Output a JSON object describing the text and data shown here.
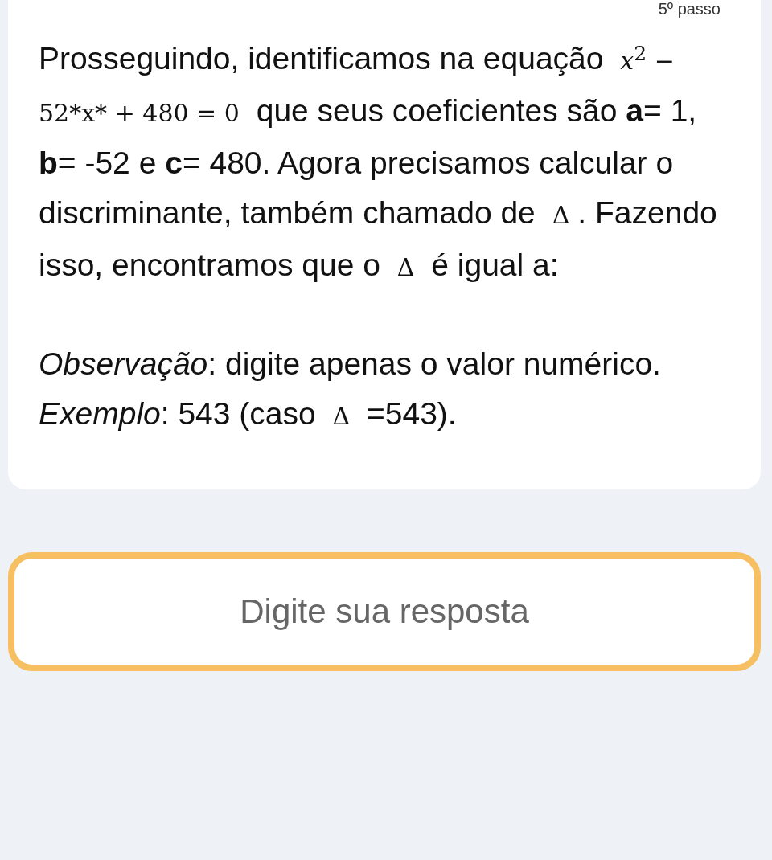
{
  "step_label": "5º passo",
  "statement": [
    {
      "kind": "text",
      "text": "Prosseguindo, identificamos na equação "
    },
    {
      "kind": "math",
      "text": "*x*$^{2}$ − 52*x* + 480 = 0"
    },
    {
      "kind": "text",
      "text": " que seus coeficientes são **a**= 1, **b**= -52 e **c**= 480. Agora precisamos calcular o discriminante, também chamado de "
    },
    {
      "kind": "math",
      "text": "Δ"
    },
    {
      "kind": "text",
      "text": ". Fazendo isso, encontramos que o "
    },
    {
      "kind": "math",
      "text": "Δ"
    },
    {
      "kind": "text",
      "text": " é igual a:"
    }
  ],
  "note": [
    {
      "kind": "text",
      "text": "*Observação*: digite apenas o valor numérico. *Exemplo*: 543 (caso "
    },
    {
      "kind": "math",
      "text": "Δ"
    },
    {
      "kind": "text",
      "text": " =543)."
    }
  ],
  "answer": {
    "placeholder": "Digite sua resposta"
  }
}
